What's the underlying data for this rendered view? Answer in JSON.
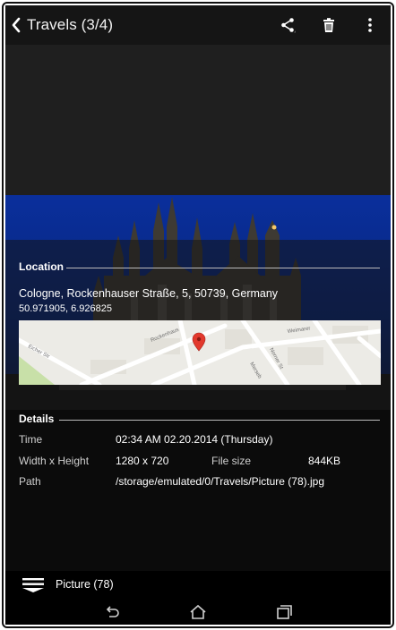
{
  "header": {
    "title": "Travels (3/4)",
    "back_icon": "chevron-left-icon",
    "actions": [
      "share-icon",
      "trash-icon",
      "overflow-menu-icon"
    ]
  },
  "location": {
    "heading": "Location",
    "address": "Cologne, Rockenhauser Straße, 5, 50739, Germany",
    "coordinates": "50.971905, 6.926825",
    "map": {
      "streets": [
        "Rockenhaus",
        "Weimarer",
        "Eicher Str",
        "Merseb",
        "Norner St"
      ],
      "pin_icon": "map-pin-icon"
    }
  },
  "details": {
    "heading": "Details",
    "time_label": "Time",
    "time_value": "02:34 AM 02.20.2014 (Thursday)",
    "size_label": "Width x Height",
    "size_value": "1280 x 720",
    "filesize_label": "File size",
    "filesize_value": "844KB",
    "path_label": "Path",
    "path_value": "/storage/emulated/0/Travels/Picture (78).jpg"
  },
  "filebar": {
    "menu_icon": "hamburger-menu-icon",
    "name": "Picture (78)"
  },
  "nav": [
    "back-icon",
    "home-icon",
    "recents-icon"
  ],
  "colors": {
    "sky": "#06257a",
    "actionbar": "#151515",
    "background": "#000000",
    "map_bg": "#ecebe6",
    "park": "#c8e0a8",
    "pin": "#e2392d"
  }
}
